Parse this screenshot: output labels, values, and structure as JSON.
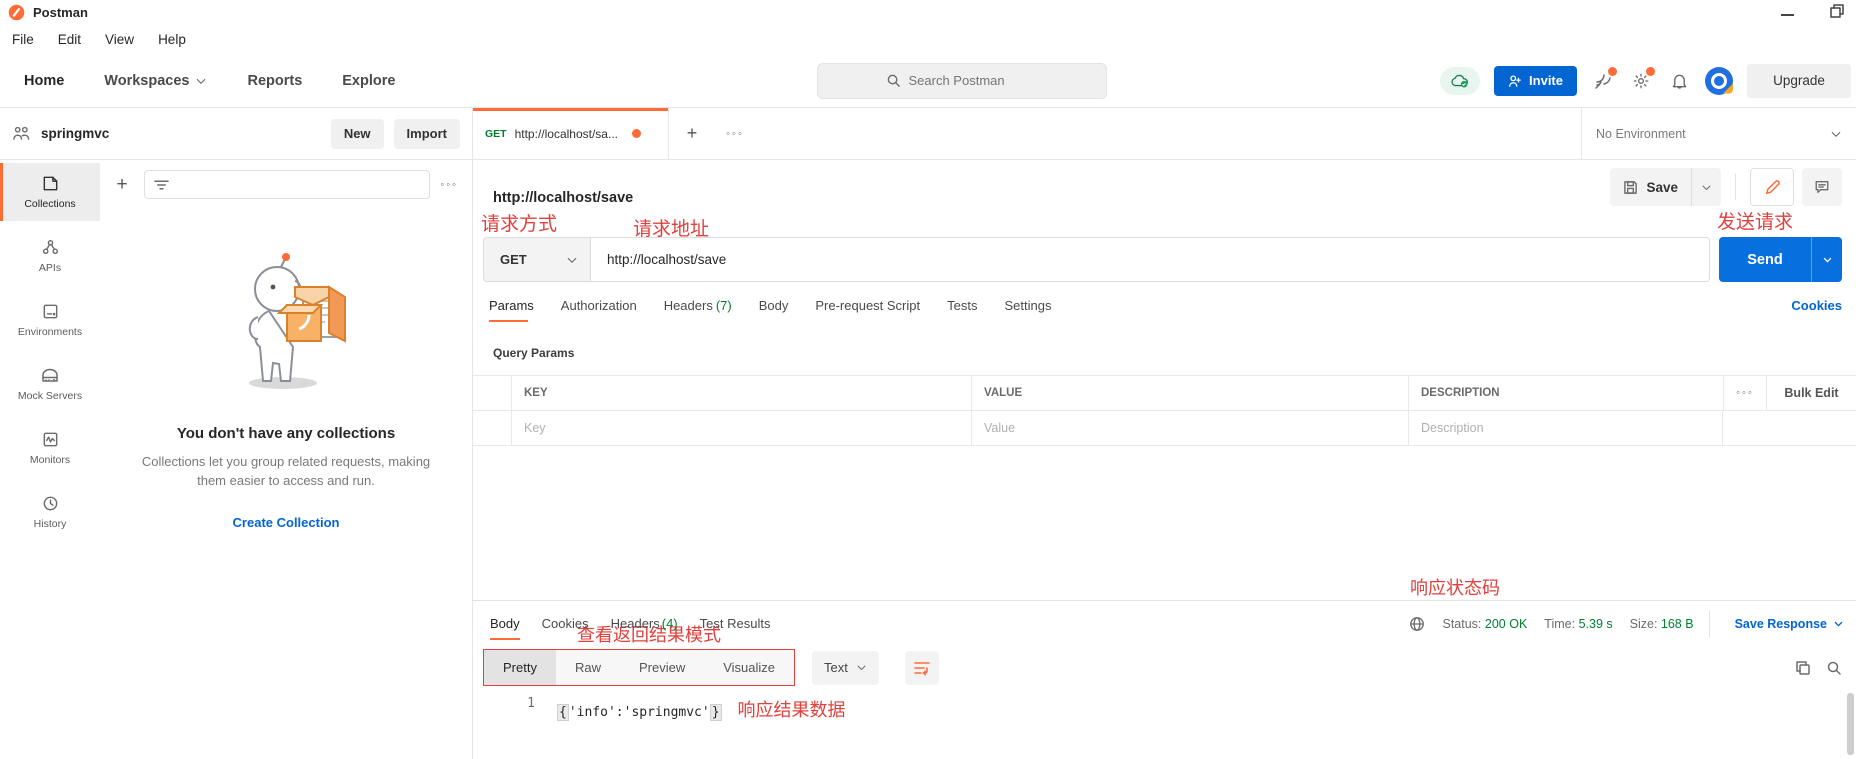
{
  "titlebar": {
    "app_name": "Postman",
    "menus": [
      "File",
      "Edit",
      "View",
      "Help"
    ]
  },
  "navbar": {
    "links": [
      "Home",
      "Workspaces",
      "Reports",
      "Explore"
    ],
    "search_placeholder": "Search Postman",
    "invite_label": "Invite",
    "upgrade_label": "Upgrade"
  },
  "sidebar": {
    "workspace_name": "springmvc",
    "new_label": "New",
    "import_label": "Import",
    "rail": [
      {
        "label": "Collections"
      },
      {
        "label": "APIs"
      },
      {
        "label": "Environments"
      },
      {
        "label": "Mock Servers"
      },
      {
        "label": "Monitors"
      },
      {
        "label": "History"
      }
    ],
    "empty_state": {
      "title": "You don't have any collections",
      "description": "Collections let you group related requests, making them easier to access and run.",
      "cta": "Create Collection"
    }
  },
  "tab_strip": {
    "method": "GET",
    "title": "http://localhost/sa...",
    "environment": "No Environment"
  },
  "request": {
    "name": "http://localhost/save",
    "method": "GET",
    "url": "http://localhost/save",
    "save_label": "Save",
    "send_label": "Send",
    "tabs": [
      {
        "label": "Params",
        "count": ""
      },
      {
        "label": "Authorization",
        "count": ""
      },
      {
        "label": "Headers",
        "count": "(7)"
      },
      {
        "label": "Body",
        "count": ""
      },
      {
        "label": "Pre-request Script",
        "count": ""
      },
      {
        "label": "Tests",
        "count": ""
      },
      {
        "label": "Settings",
        "count": ""
      }
    ],
    "cookies_link": "Cookies",
    "params_section": {
      "title": "Query Params",
      "columns": [
        "KEY",
        "VALUE",
        "DESCRIPTION"
      ],
      "placeholders": [
        "Key",
        "Value",
        "Description"
      ],
      "bulk_edit": "Bulk Edit"
    }
  },
  "response": {
    "tabs": [
      {
        "label": "Body",
        "count": ""
      },
      {
        "label": "Cookies",
        "count": ""
      },
      {
        "label": "Headers",
        "count": "(4)"
      },
      {
        "label": "Test Results",
        "count": ""
      }
    ],
    "status_label": "Status:",
    "status_value": "200 OK",
    "time_label": "Time:",
    "time_value": "5.39 s",
    "size_label": "Size:",
    "size_value": "168 B",
    "save_response_label": "Save Response",
    "view_modes": [
      "Pretty",
      "Raw",
      "Preview",
      "Visualize"
    ],
    "active_mode": "Pretty",
    "format": "Text",
    "line_number": "1",
    "body_open": "{",
    "body_content": "'info':'springmvc'",
    "body_close": "}"
  },
  "annotations": {
    "request_method": "请求方式",
    "request_url": "请求地址",
    "send_request": "发送请求",
    "response_status": "响应状态码",
    "view_result_mode": "查看返回结果模式",
    "response_data": "响应结果数据"
  }
}
